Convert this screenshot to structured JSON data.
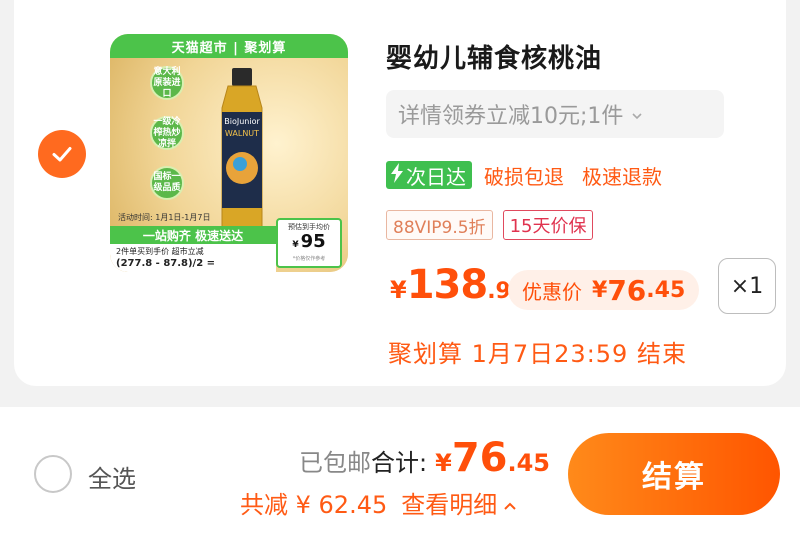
{
  "colors": {
    "accent": "#ff5a14",
    "price": "#ff4f0a",
    "green": "#3fbf4f"
  },
  "item": {
    "selected": true,
    "image": {
      "top_banner": "天猫超市 | 聚划算",
      "brand": "BioJunior",
      "product_word": "WALNUT",
      "tags": [
        "意大利原装进口",
        "一级冷榨热炒凉拌",
        "国标一级品质"
      ],
      "promo_date": "活动时间: 1月1日-1月7日",
      "green_band": "一站购齐 极速送达",
      "formula_header": "2件单买到手价    超市立减",
      "formula": "(277.8  -  87.8)/2  =",
      "price_label": "预估到手均价",
      "price_yen": "¥",
      "price_value": "95",
      "price_note": "*价格仅作参考"
    },
    "title": "婴幼儿辅食核桃油",
    "sku_text": "详情领券立减10元;1件",
    "services": {
      "next_day": "次日达",
      "svc1": "破损包退",
      "svc2": "极速退款"
    },
    "badges": {
      "vip": "88VIP9.5折",
      "price_protect": "15天价保"
    },
    "price": {
      "symbol": "¥",
      "int": "138",
      "dec": ".9"
    },
    "deal": {
      "label": "优惠价",
      "symbol": "¥",
      "int": "76",
      "dec": ".45"
    },
    "quantity": "×1",
    "promo_end": "聚划算 1月7日23:59 结束"
  },
  "footer": {
    "select_all": "全选",
    "shipping": "已包邮",
    "total_label": "合计:",
    "total_symbol": "¥",
    "total_int": "76",
    "total_dec": ".45",
    "saving": "共减 ¥ 62.45",
    "detail": "查看明细",
    "checkout": "结算"
  }
}
